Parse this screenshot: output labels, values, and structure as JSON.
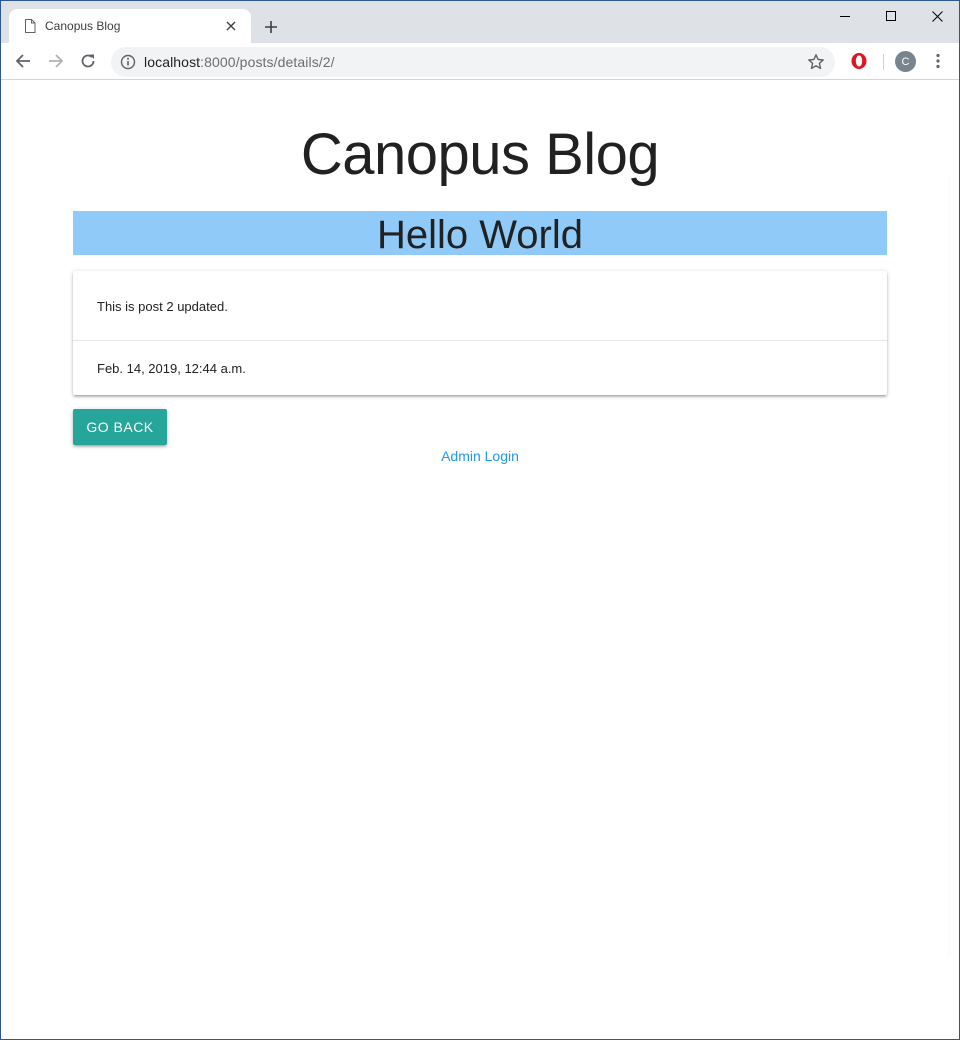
{
  "browser": {
    "tab_title": "Canopus Blog",
    "url_host": "localhost",
    "url_rest": ":8000/posts/details/2/",
    "profile_initial": "C"
  },
  "icons": {
    "tab_favicon": "page-icon",
    "tab_close": "close-icon",
    "new_tab": "plus-icon",
    "minimize": "minimize-icon",
    "maximize": "maximize-icon",
    "close_window": "close-icon",
    "back": "arrow-left-icon",
    "forward": "arrow-right-icon",
    "reload": "reload-icon",
    "site_info": "info-icon",
    "bookmark": "star-icon",
    "opera": "opera-icon",
    "menu": "kebab-menu-icon"
  },
  "page": {
    "blog_title": "Canopus Blog",
    "post_title": "Hello World",
    "post_body": "This is post 2 updated.",
    "post_date": "Feb. 14, 2019, 12:44 a.m.",
    "back_button": "GO BACK",
    "admin_link": "Admin Login"
  },
  "colors": {
    "title_bar": "#90caf9",
    "button": "#26a69a",
    "link": "#2196f3"
  }
}
